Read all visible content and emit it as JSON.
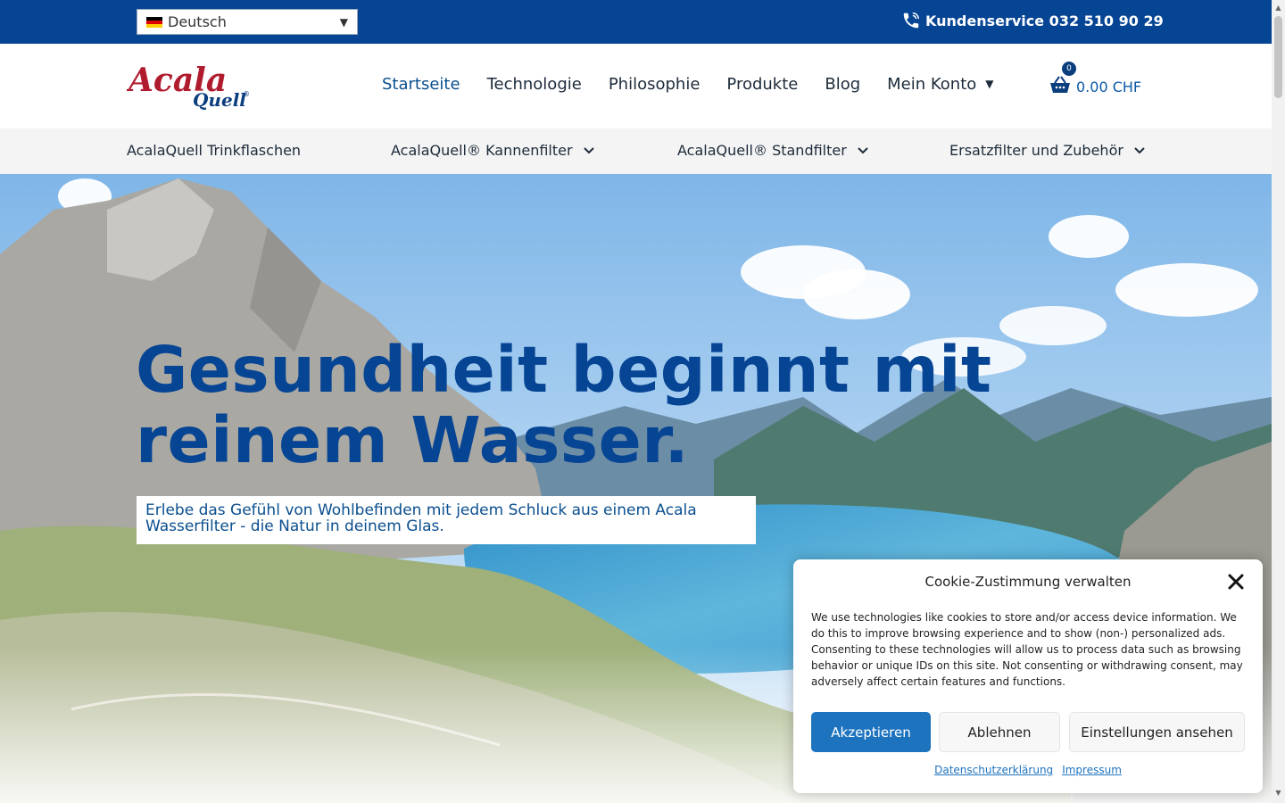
{
  "topbar": {
    "language": "Deutsch",
    "service": "Kundenservice 032 510 90 29"
  },
  "logo": {
    "line1": "Acala",
    "line2": "Quell",
    "mark": "®"
  },
  "nav": {
    "items": [
      {
        "label": "Startseite",
        "active": true
      },
      {
        "label": "Technologie"
      },
      {
        "label": "Philosophie"
      },
      {
        "label": "Produkte"
      },
      {
        "label": "Blog"
      },
      {
        "label": "Mein Konto"
      }
    ]
  },
  "cart": {
    "count": "0",
    "total": "0.00 CHF"
  },
  "categories": [
    {
      "label": "AcalaQuell Trinkflaschen"
    },
    {
      "label": "AcalaQuell® Kannenfilter"
    },
    {
      "label": "AcalaQuell® Standfilter"
    },
    {
      "label": "Ersatzfilter und Zubehör"
    }
  ],
  "hero": {
    "title_line1": "Gesundheit beginnt mit",
    "title_line2": "reinem Wasser.",
    "subtitle": "Erlebe das Gefühl von Wohlbefinden mit jedem Schluck aus einem Acala Wasserfilter - die Natur in deinem Glas."
  },
  "cookie": {
    "title": "Cookie-Zustimmung verwalten",
    "text": "We use technologies like cookies to store and/or access device information. We do this to improve browsing experience and to show (non-) personalized ads. Consenting to these technologies will allow us to process data such as browsing behavior or unique IDs on this site. Not consenting or withdrawing consent, may adversely affect certain features and functions.",
    "accept": "Akzeptieren",
    "decline": "Ablehnen",
    "preferences": "Einstellungen ansehen",
    "privacy_link": "Datenschutzerklärung",
    "imprint_link": "Impressum"
  },
  "colors": {
    "brand_blue": "#064494",
    "logo_red": "#b01b2e",
    "accept_blue": "#1e73be"
  }
}
